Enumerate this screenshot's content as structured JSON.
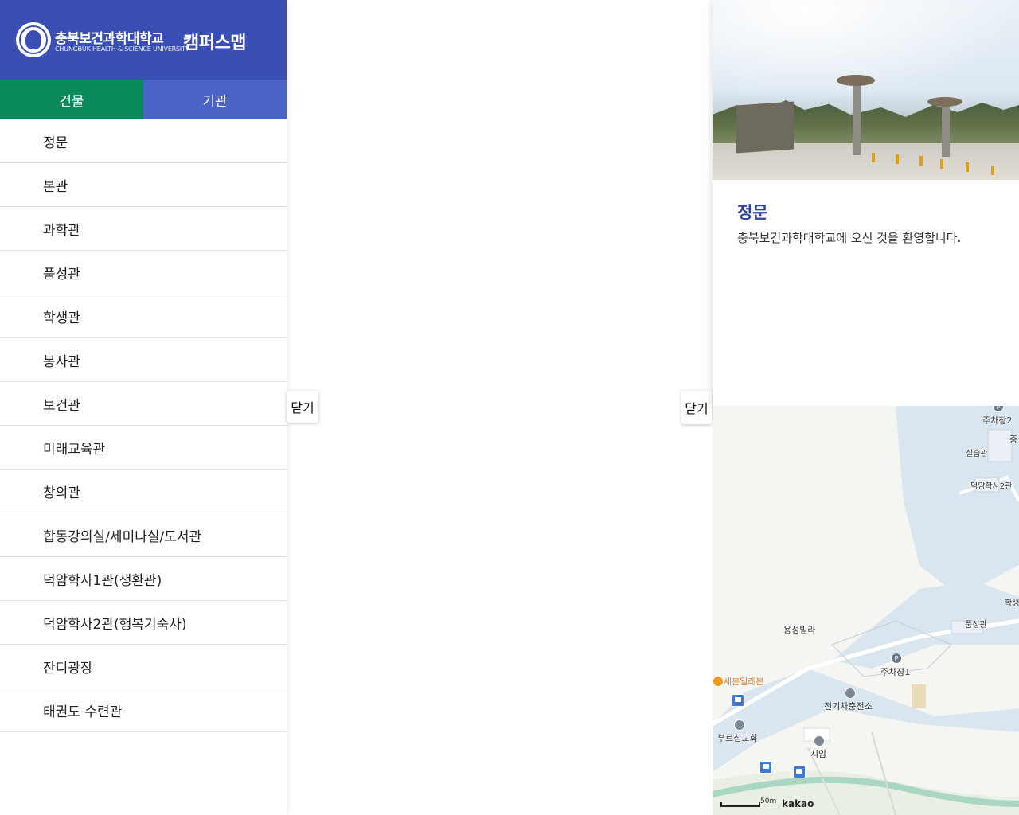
{
  "brand": {
    "korean_name": "충북보건과학대학교",
    "english_name": "CHUNGBUK HEALTH & SCIENCE UNIVERSITY",
    "map_title": "캠퍼스맵"
  },
  "tabs": [
    {
      "label": "건물",
      "active": true
    },
    {
      "label": "기관",
      "active": false
    }
  ],
  "buildings": [
    "정문",
    "본관",
    "과학관",
    "품성관",
    "학생관",
    "봉사관",
    "보건관",
    "미래교육관",
    "창의관",
    "합동강의실/세미나실/도서관",
    "덕암학사1관(생환관)",
    "덕암학사2관(행복기숙사)",
    "잔디광장",
    "태권도 수련관"
  ],
  "close_left": "닫기",
  "close_right": "닫기",
  "info": {
    "title": "정문",
    "description": "충북보건과학대학교에 오신 것을 환영합니다."
  },
  "map": {
    "labels": {
      "parking2": "주차장2",
      "practice_hall": "실습관",
      "dorm2": "덕암학사2관",
      "student_hall": "학생",
      "pumseong": "품성관",
      "yongseong_villa": "용성빌라",
      "parking1": "주차장1",
      "seven_eleven": "세븐일레븐",
      "ev_charger": "전기차충전소",
      "church": "부르심교회",
      "siam": "시암",
      "edge_char": "중"
    },
    "scale_label": "50m",
    "provider": "kakao"
  },
  "colors": {
    "brand_blue": "#3a4fb3",
    "active_tab_green": "#0a8a5a",
    "inactive_tab_blue": "#4a63c8",
    "title_blue": "#2f45a6",
    "campus_area": "#d9e6ef"
  }
}
